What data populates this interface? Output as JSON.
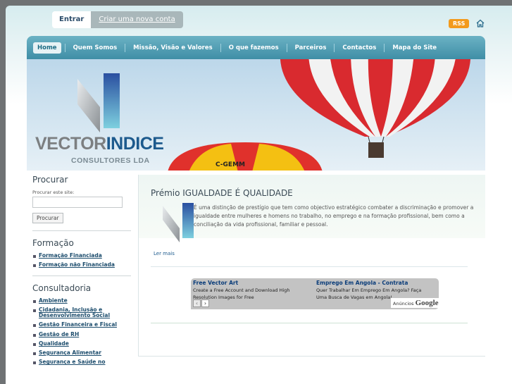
{
  "top": {
    "login_label": "Entrar",
    "create_account_label": "Criar uma nova conta",
    "rss_label": "RSS",
    "home_icon": "home-icon"
  },
  "nav": {
    "items": [
      {
        "label": "Home",
        "active": true
      },
      {
        "label": "Quem Somos"
      },
      {
        "label": "Missão, Visão e Valores"
      },
      {
        "label": "O que fazemos"
      },
      {
        "label": "Parceiros"
      },
      {
        "label": "Contactos"
      },
      {
        "label": "Mapa do Site"
      }
    ]
  },
  "banner": {
    "logo_part1": "VECTOR",
    "logo_part2": "INDICE",
    "logo_sub": "CONSULTORES LDA",
    "balloon_text": "C-GEMM"
  },
  "sidebar": {
    "search_heading": "Procurar",
    "search_label": "Procurar este site:",
    "search_button": "Procurar",
    "formacao_heading": "Formação",
    "formacao_items": [
      "Formação Financiada",
      "Formação não Financiada"
    ],
    "consultadoria_heading": "Consultadoria",
    "consultadoria_items": [
      "Ambiente",
      "Cidadania, Inclusão e Desenvolvimento Social",
      "Gestão Financeira e Fiscal",
      "Gestão de RH",
      "Qualidade",
      "Segurança Alimentar",
      "Segurança e Saúde no"
    ]
  },
  "main": {
    "post_title": "Prémio IGUALDADE É QUALIDADE",
    "post_text": "É uma distinção de prestígio que tem como objectivo estratégico combater a discriminação e promover a igualdade entre mulheres e homens no trabalho, no emprego e na formação profissional, bem como a conciliação da vida profissional, familiar e pessoal.",
    "read_more": "Ler mais"
  },
  "ads": {
    "ad1_title": "Free Vector Art",
    "ad1_text": "Create a Free Account and Download High Resolution Images for Free",
    "ad2_title": "Emprego Em Angola - Contrata",
    "ad2_text": "Quer Trabalhar Em Emprego Em Angola? Faça Uma Busca de Vagas em Angola!",
    "ads_by": "Anúncios",
    "google": "Google"
  },
  "colors": {
    "nav_gradient_top": "#6bb2c4",
    "nav_gradient_bottom": "#3f8ea6",
    "link": "#1d4d6d",
    "rss": "#f39a1c"
  }
}
